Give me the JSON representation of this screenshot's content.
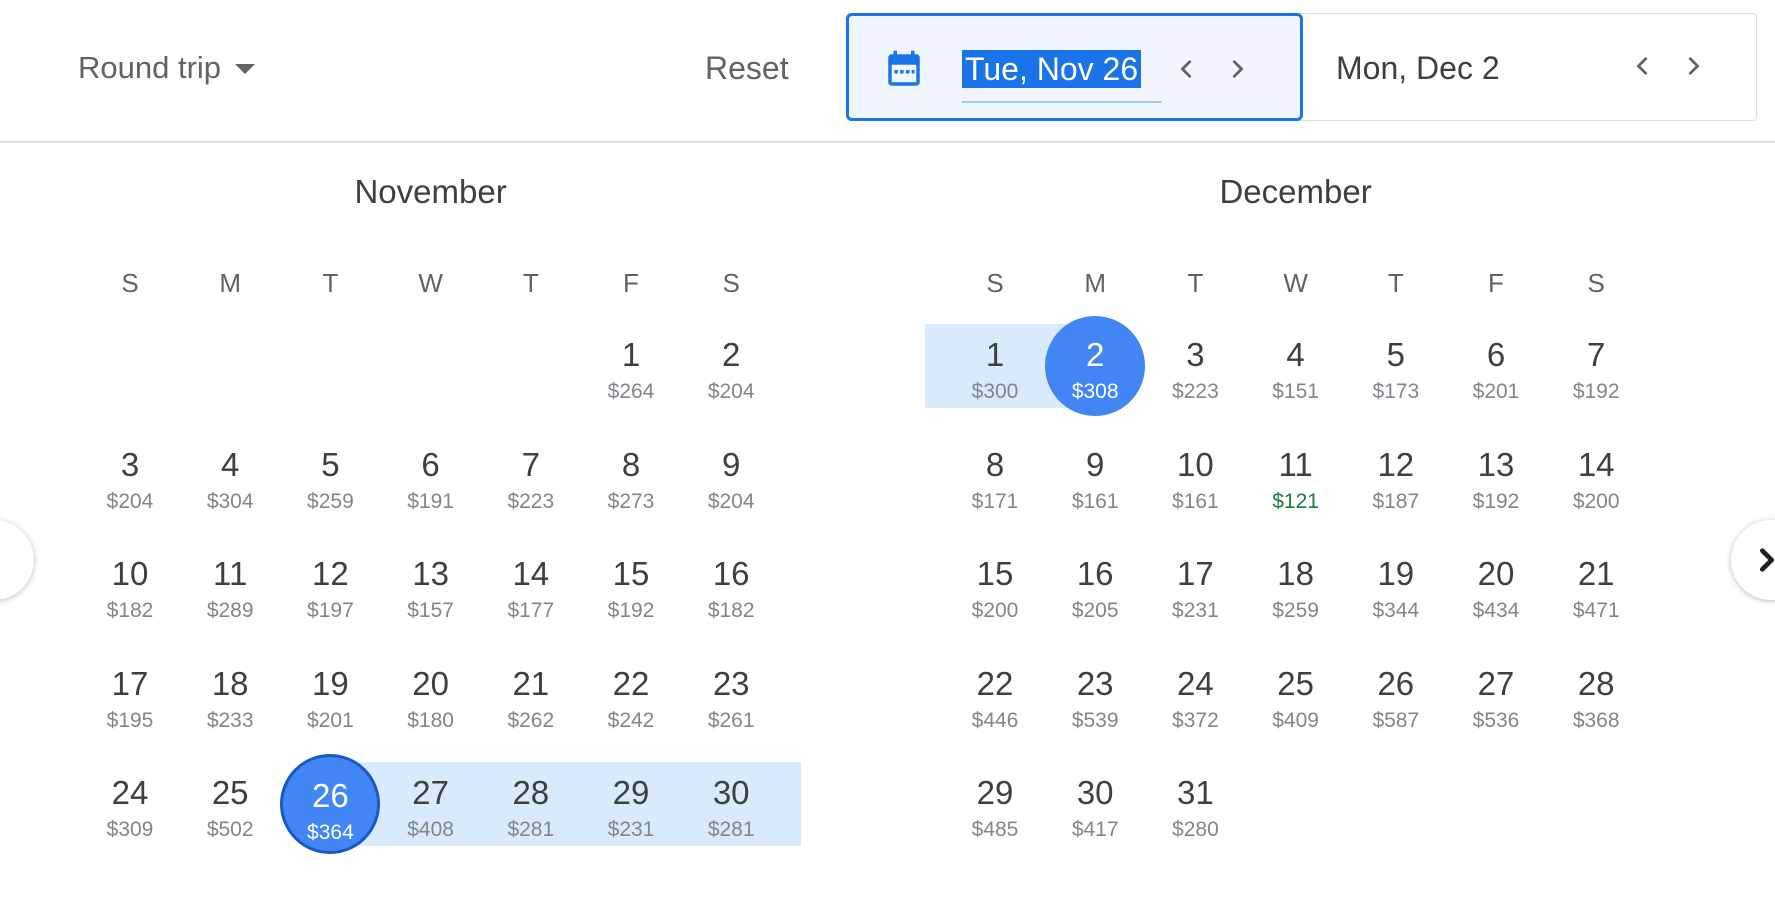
{
  "header": {
    "trip_type": "Round trip",
    "reset_label": "Reset",
    "departure": {
      "value": "Tue, Nov 26",
      "icon": "calendar-icon"
    },
    "return": {
      "value": "Mon, Dec 2"
    }
  },
  "colors": {
    "accent": "#1a73e8",
    "selected": "#4285f4",
    "range": "#d9eafc",
    "low_price": "#188038"
  },
  "weekdays": [
    "S",
    "M",
    "T",
    "W",
    "T",
    "F",
    "S"
  ],
  "months": [
    {
      "name": "November",
      "first_weekday": 5,
      "days": [
        {
          "d": "1",
          "p": "$264"
        },
        {
          "d": "2",
          "p": "$204"
        },
        {
          "d": "3",
          "p": "$204"
        },
        {
          "d": "4",
          "p": "$304"
        },
        {
          "d": "5",
          "p": "$259"
        },
        {
          "d": "6",
          "p": "$191"
        },
        {
          "d": "7",
          "p": "$223"
        },
        {
          "d": "8",
          "p": "$273"
        },
        {
          "d": "9",
          "p": "$204"
        },
        {
          "d": "10",
          "p": "$182"
        },
        {
          "d": "11",
          "p": "$289"
        },
        {
          "d": "12",
          "p": "$197"
        },
        {
          "d": "13",
          "p": "$157"
        },
        {
          "d": "14",
          "p": "$177"
        },
        {
          "d": "15",
          "p": "$192"
        },
        {
          "d": "16",
          "p": "$182"
        },
        {
          "d": "17",
          "p": "$195"
        },
        {
          "d": "18",
          "p": "$233"
        },
        {
          "d": "19",
          "p": "$201"
        },
        {
          "d": "20",
          "p": "$180"
        },
        {
          "d": "21",
          "p": "$262"
        },
        {
          "d": "22",
          "p": "$242"
        },
        {
          "d": "23",
          "p": "$261"
        },
        {
          "d": "24",
          "p": "$309"
        },
        {
          "d": "25",
          "p": "$502"
        },
        {
          "d": "26",
          "p": "$364",
          "selected": true,
          "outlined": true
        },
        {
          "d": "27",
          "p": "$408",
          "in_range": true
        },
        {
          "d": "28",
          "p": "$281",
          "in_range": true
        },
        {
          "d": "29",
          "p": "$231",
          "in_range": true
        },
        {
          "d": "30",
          "p": "$281",
          "in_range": true
        }
      ]
    },
    {
      "name": "December",
      "first_weekday": 0,
      "days": [
        {
          "d": "1",
          "p": "$300",
          "in_range": true
        },
        {
          "d": "2",
          "p": "$308",
          "selected": true
        },
        {
          "d": "3",
          "p": "$223"
        },
        {
          "d": "4",
          "p": "$151"
        },
        {
          "d": "5",
          "p": "$173"
        },
        {
          "d": "6",
          "p": "$201"
        },
        {
          "d": "7",
          "p": "$192"
        },
        {
          "d": "8",
          "p": "$171"
        },
        {
          "d": "9",
          "p": "$161"
        },
        {
          "d": "10",
          "p": "$161"
        },
        {
          "d": "11",
          "p": "$121",
          "low": true
        },
        {
          "d": "12",
          "p": "$187"
        },
        {
          "d": "13",
          "p": "$192"
        },
        {
          "d": "14",
          "p": "$200"
        },
        {
          "d": "15",
          "p": "$200"
        },
        {
          "d": "16",
          "p": "$205"
        },
        {
          "d": "17",
          "p": "$231"
        },
        {
          "d": "18",
          "p": "$259"
        },
        {
          "d": "19",
          "p": "$344"
        },
        {
          "d": "20",
          "p": "$434"
        },
        {
          "d": "21",
          "p": "$471"
        },
        {
          "d": "22",
          "p": "$446"
        },
        {
          "d": "23",
          "p": "$539"
        },
        {
          "d": "24",
          "p": "$372"
        },
        {
          "d": "25",
          "p": "$409"
        },
        {
          "d": "26",
          "p": "$587"
        },
        {
          "d": "27",
          "p": "$536"
        },
        {
          "d": "28",
          "p": "$368"
        },
        {
          "d": "29",
          "p": "$485"
        },
        {
          "d": "30",
          "p": "$417"
        },
        {
          "d": "31",
          "p": "$280"
        }
      ]
    }
  ]
}
